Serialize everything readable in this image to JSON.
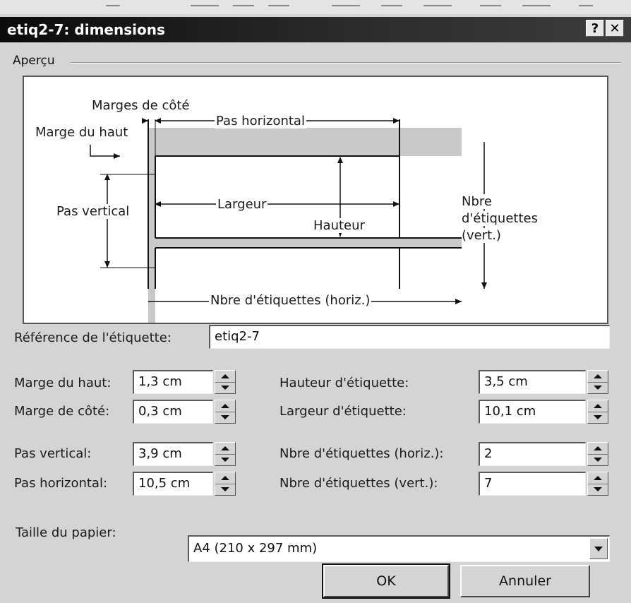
{
  "window": {
    "title": "etiq2-7: dimensions",
    "help_label": "?",
    "close_label": "✕"
  },
  "preview": {
    "group_label": "Aperçu",
    "labels": {
      "side_margins": "Marges de côté",
      "top_margin": "Marge du haut",
      "horizontal_pitch": "Pas horizontal",
      "vertical_pitch": "Pas vertical",
      "width": "Largeur",
      "height": "Hauteur",
      "labels_across_1": "Nbre",
      "labels_across_2": "d'étiquettes",
      "labels_across_3": "(vert.)",
      "labels_horiz": "Nbre d'étiquettes (horiz.)"
    }
  },
  "reference": {
    "label": "Référence de l'étiquette:",
    "value": "etiq2-7"
  },
  "fields": {
    "top_margin": {
      "label": "Marge du haut:",
      "value": "1,3 cm"
    },
    "side_margin": {
      "label": "Marge de côté:",
      "value": "0,3 cm"
    },
    "vertical_pitch": {
      "label": "Pas vertical:",
      "value": "3,9 cm"
    },
    "horizontal_pitch": {
      "label": "Pas horizontal:",
      "value": "10,5 cm"
    },
    "label_height": {
      "label": "Hauteur d'étiquette:",
      "value": "3,5 cm"
    },
    "label_width": {
      "label": "Largeur d'étiquette:",
      "value": "10,1 cm"
    },
    "count_horiz": {
      "label": "Nbre d'étiquettes (horiz.):",
      "value": "2"
    },
    "count_vert": {
      "label": "Nbre d'étiquettes (vert.):",
      "value": "7"
    }
  },
  "paper": {
    "label": "Taille du papier:",
    "value": "A4 (210 x 297 mm)"
  },
  "buttons": {
    "ok": "OK",
    "cancel": "Annuler"
  },
  "icons": {
    "up": "spin-up-icon",
    "down": "spin-down-icon",
    "dropdown": "chevron-down-icon"
  }
}
